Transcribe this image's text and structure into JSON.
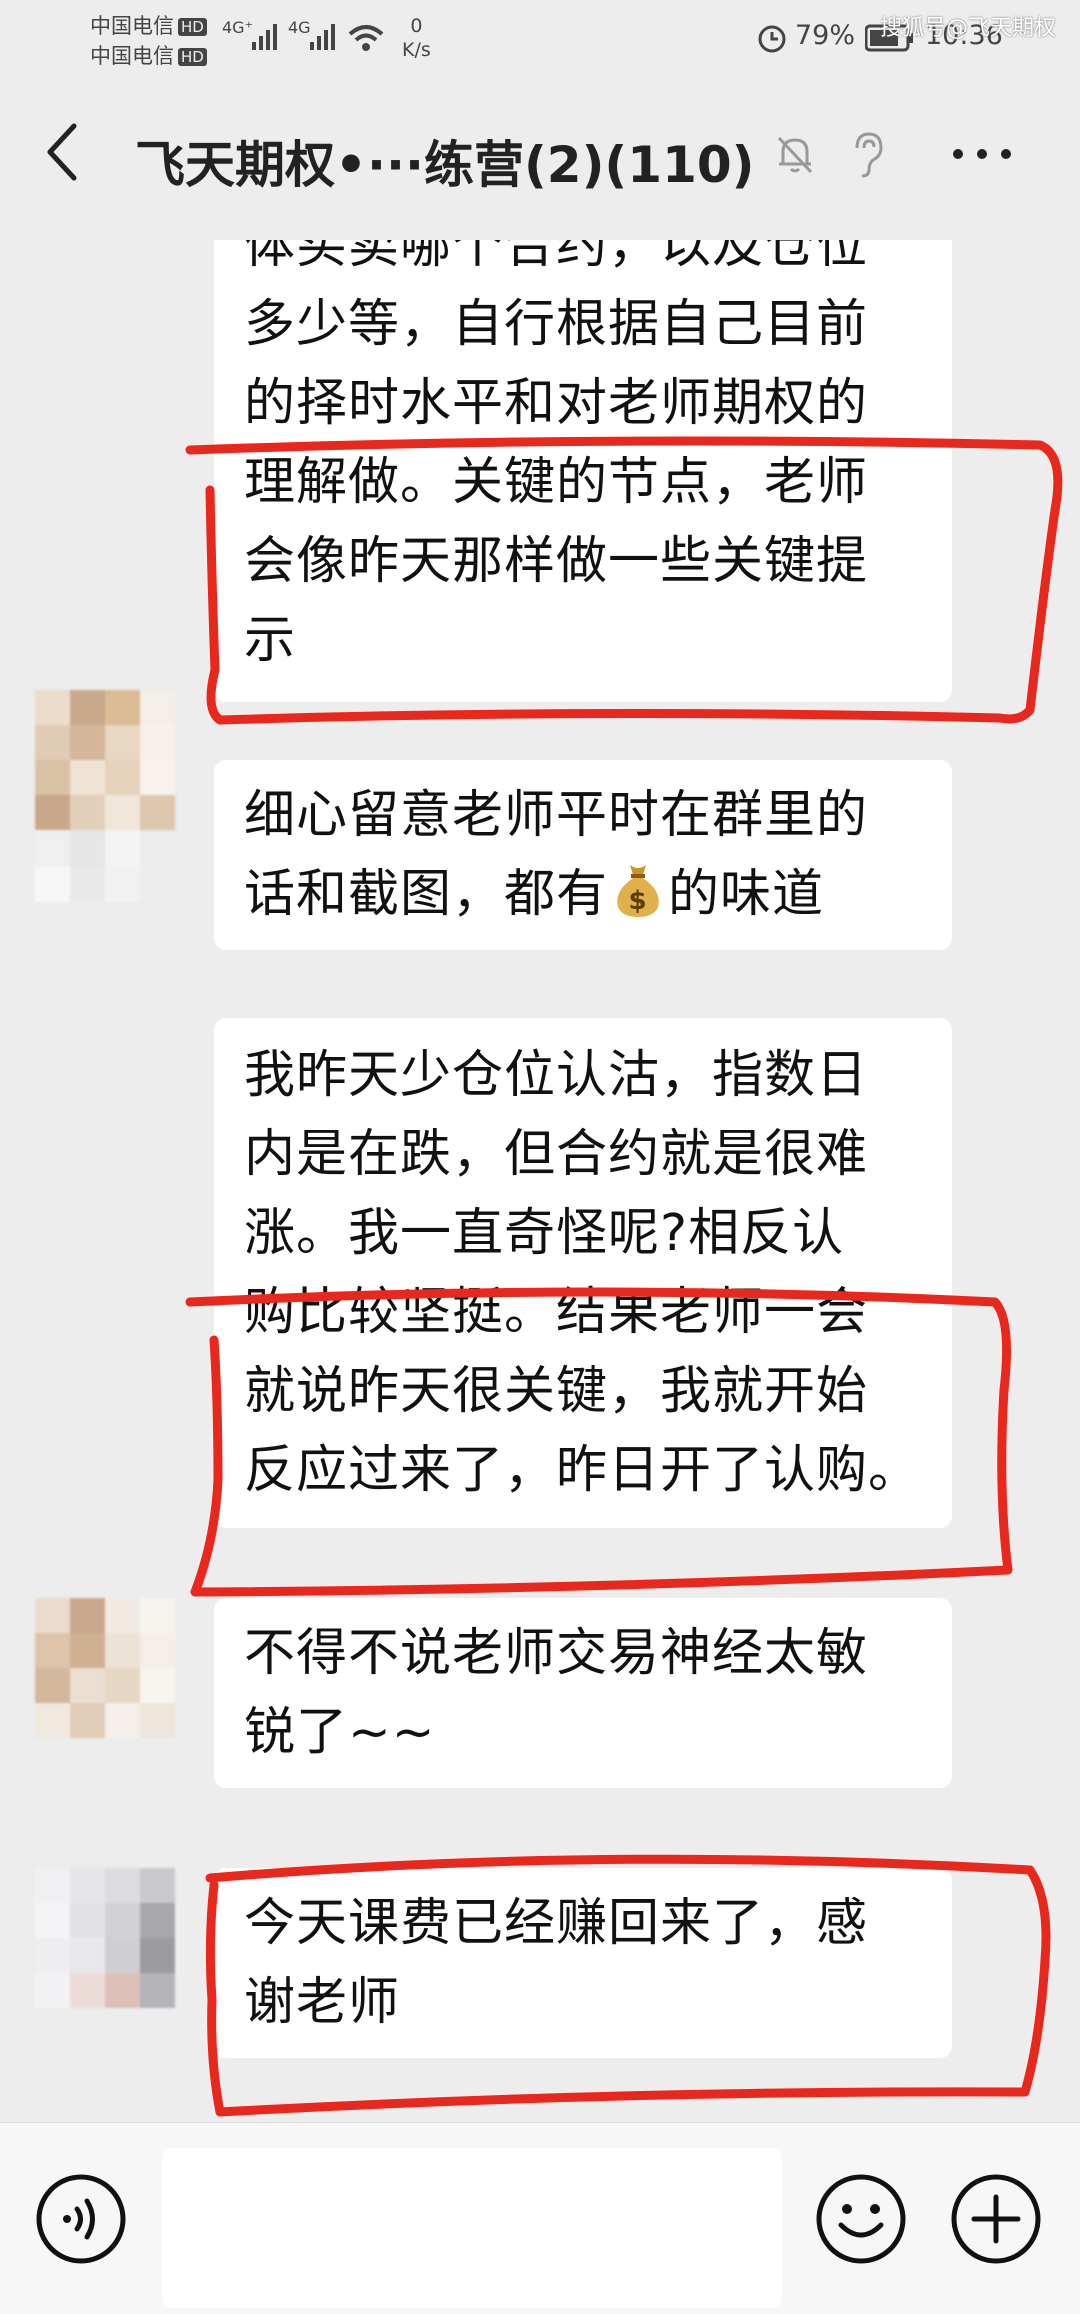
{
  "status_bar": {
    "carrier1": "中国电信",
    "carrier2": "中国电信",
    "hd": "HD",
    "signal1": "4G⁺",
    "signal2": "4G",
    "net_speed_value": "0",
    "net_speed_unit": "K/s",
    "battery": "79%",
    "time": "10:36",
    "watermark": "搜狐号@飞天期权"
  },
  "header": {
    "title": "飞天期权•···练营(2)(110)"
  },
  "messages": [
    {
      "lines": [
        "体买卖哪个合约，以及仓位",
        "多少等，自行根据自己目前",
        "的择时水平和对老师期权的",
        "理解做。关键的节点，老师",
        "会像昨天那样做一些关键提",
        "示"
      ]
    },
    {
      "line1": "细心留意老师平时在群里的",
      "line2_before": "话和截图，都有",
      "emoji": "moneybag",
      "line2_after": "的味道"
    },
    {
      "lines": [
        "我昨天少仓位认沽，指数日",
        "内是在跌，但合约就是很难",
        "涨。我一直奇怪呢?相反认",
        "购比较坚挺。结果老师一会",
        "就说昨天很关键，我就开始",
        "反应过来了，昨日开了认购。"
      ]
    },
    {
      "lines": [
        "不得不说老师交易神经太敏",
        "锐了~~"
      ]
    },
    {
      "lines": [
        "今天课费已经赚回来了，感",
        "谢老师"
      ]
    }
  ],
  "colors": {
    "highlight": "#e8281c",
    "background": "#ededed",
    "bubble": "#ffffff"
  }
}
